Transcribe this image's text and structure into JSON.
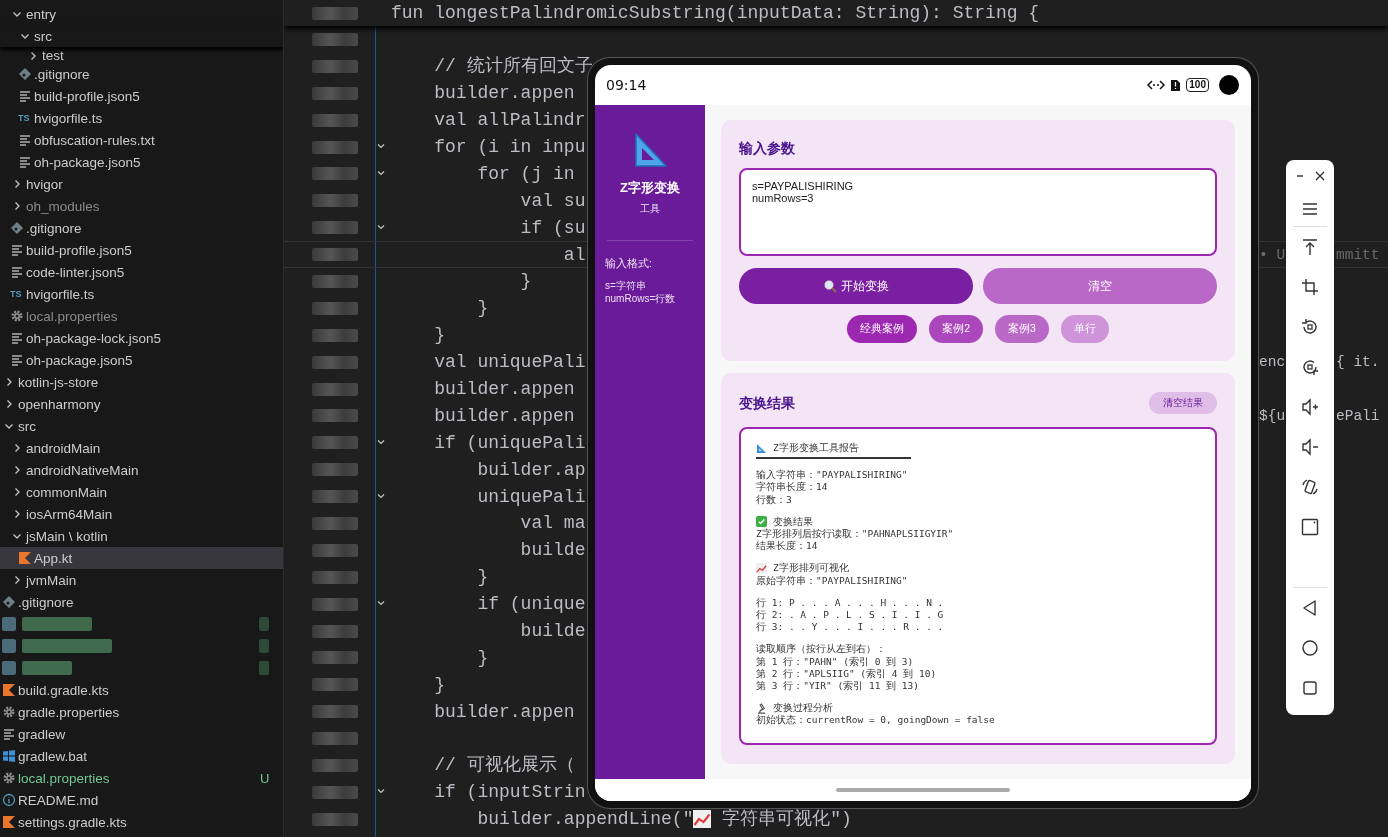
{
  "explorer": {
    "partial_children": [
      {
        "label": "entry",
        "kind": "folder",
        "expanded": true,
        "selected": false,
        "dimmed": false,
        "children": [
          {
            "label": "src",
            "kind": "folder",
            "expanded": true,
            "selected": false,
            "dimmed": false,
            "children": [
              {
                "label": "test",
                "kind": "folder",
                "expanded": false,
                "selected": false,
                "dimmed": false
              }
            ]
          },
          {
            "label": ".gitignore",
            "kind": "git",
            "selected": false,
            "dimmed": false
          },
          {
            "label": "build-profile.json5",
            "kind": "text",
            "selected": false,
            "dimmed": false
          },
          {
            "label": "hvigorfile.ts",
            "kind": "ts",
            "icon_text": "TS",
            "selected": false,
            "dimmed": false
          },
          {
            "label": "obfuscation-rules.txt",
            "kind": "text",
            "selected": false,
            "dimmed": false
          },
          {
            "label": "oh-package.json5",
            "kind": "text",
            "selected": false,
            "dimmed": false
          }
        ]
      },
      {
        "label": "hvigor",
        "kind": "folder",
        "expanded": false,
        "selected": false,
        "dimmed": false
      },
      {
        "label": "oh_modules",
        "kind": "folder",
        "expanded": false,
        "selected": false,
        "dimmed": true
      },
      {
        "label": ".gitignore",
        "kind": "git",
        "selected": false,
        "dimmed": false
      },
      {
        "label": "build-profile.json5",
        "kind": "text",
        "selected": false,
        "dimmed": false
      },
      {
        "label": "code-linter.json5",
        "kind": "text",
        "selected": false,
        "dimmed": false
      },
      {
        "label": "hvigorfile.ts",
        "kind": "ts",
        "icon_text": "TS",
        "selected": false,
        "dimmed": false
      },
      {
        "label": "local.properties",
        "kind": "gear",
        "selected": false,
        "dimmed": true
      },
      {
        "label": "oh-package-lock.json5",
        "kind": "text",
        "selected": false,
        "dimmed": false
      },
      {
        "label": "oh-package.json5",
        "kind": "text",
        "selected": false,
        "dimmed": false
      }
    ],
    "items": [
      {
        "label": "kotlin-js-store",
        "kind": "folder",
        "expanded": false,
        "selected": false,
        "dimmed": false
      },
      {
        "label": "openharmony",
        "kind": "folder",
        "expanded": false,
        "selected": false,
        "dimmed": false
      },
      {
        "label": "src",
        "kind": "folder",
        "expanded": true,
        "selected": false,
        "dimmed": false,
        "children": [
          {
            "label": "androidMain",
            "kind": "folder",
            "expanded": false,
            "selected": false,
            "dimmed": false
          },
          {
            "label": "androidNativeMain",
            "kind": "folder",
            "expanded": false,
            "selected": false,
            "dimmed": false
          },
          {
            "label": "commonMain",
            "kind": "folder",
            "expanded": false,
            "selected": false,
            "dimmed": false
          },
          {
            "label": "iosArm64Main",
            "kind": "folder",
            "expanded": false,
            "selected": false,
            "dimmed": false
          },
          {
            "label": "jsMain \\ kotlin",
            "kind": "folder",
            "expanded": true,
            "selected": false,
            "dimmed": false,
            "children": [
              {
                "label": "App.kt",
                "kind": "kotlin",
                "selected": true,
                "dimmed": false
              }
            ]
          },
          {
            "label": "jvmMain",
            "kind": "folder",
            "expanded": false,
            "selected": false,
            "dimmed": false
          }
        ]
      },
      {
        "label": ".gitignore",
        "kind": "git",
        "selected": false,
        "dimmed": false
      },
      {
        "kind": "redacted",
        "selected": false,
        "dimmed": false
      },
      {
        "kind": "redacted",
        "selected": false,
        "dimmed": false
      },
      {
        "kind": "redacted",
        "selected": false,
        "dimmed": false
      },
      {
        "label": "build.gradle.kts",
        "kind": "kotlin",
        "selected": false,
        "dimmed": false
      },
      {
        "label": "gradle.properties",
        "kind": "gear",
        "selected": false,
        "dimmed": false
      },
      {
        "label": "gradlew",
        "kind": "text",
        "selected": false,
        "dimmed": false
      },
      {
        "label": "gradlew.bat",
        "kind": "windows",
        "selected": false,
        "dimmed": false
      },
      {
        "label": "local.properties",
        "kind": "gear",
        "selected": false,
        "dimmed": false,
        "status": "U"
      },
      {
        "label": "README.md",
        "kind": "info",
        "selected": false,
        "dimmed": false
      },
      {
        "label": "settings.gradle.kts",
        "kind": "kotlin",
        "selected": false,
        "dimmed": false
      }
    ]
  },
  "editor": {
    "sticky_line": "fun longestPalindromicSubstring(inputData: String): String {",
    "lines": [
      {
        "foldable": false,
        "current": false
      },
      {
        "text": "    // 统计所有回文子",
        "foldable": false,
        "current": false
      },
      {
        "text": "    builder.appen",
        "foldable": false,
        "current": false
      },
      {
        "text": "    val allPalindr",
        "foldable": false,
        "current": false
      },
      {
        "text": "    for (i in inpu",
        "foldable": true,
        "current": false
      },
      {
        "text": "        for (j in",
        "foldable": true,
        "current": false
      },
      {
        "text": "            val su",
        "foldable": false,
        "current": false
      },
      {
        "text": "            if (su",
        "foldable": true,
        "current": false
      },
      {
        "text": "                al",
        "foldable": false,
        "current": true,
        "blame": [
          "• U",
          "mmitt"
        ]
      },
      {
        "text": "            }",
        "foldable": false,
        "current": false
      },
      {
        "text": "        }",
        "foldable": false,
        "current": false
      },
      {
        "text": "    }",
        "foldable": false,
        "current": false
      },
      {
        "text": "    val uniquePali",
        "foldable": false,
        "current": false,
        "tail": [
          "enc",
          "{ it."
        ]
      },
      {
        "text": "    builder.appen",
        "foldable": false,
        "current": false
      },
      {
        "text": "    builder.appen",
        "foldable": false,
        "current": false,
        "tail": [
          "${u",
          "ePali"
        ]
      },
      {
        "text": "    if (uniquePali",
        "foldable": true,
        "current": false
      },
      {
        "text": "        builder.ap",
        "foldable": false,
        "current": false
      },
      {
        "text": "        uniquePali",
        "foldable": true,
        "current": false
      },
      {
        "text": "            val ma",
        "foldable": false,
        "current": false
      },
      {
        "text": "            builde",
        "foldable": false,
        "current": false
      },
      {
        "text": "        }",
        "foldable": false,
        "current": false
      },
      {
        "text": "        if (unique",
        "foldable": true,
        "current": false
      },
      {
        "text": "            builde",
        "foldable": false,
        "current": false
      },
      {
        "text": "        }",
        "foldable": false,
        "current": false
      },
      {
        "text": "    }",
        "foldable": false,
        "current": false
      },
      {
        "text": "    builder.appen",
        "foldable": false,
        "current": false
      },
      {
        "foldable": false,
        "current": false
      },
      {
        "text": "    // 可视化展示（",
        "foldable": false,
        "current": false
      },
      {
        "text": "    if (inputStrin",
        "foldable": true,
        "current": false
      },
      {
        "text": "        builder.appendLine(\"",
        "rest": " 字符串可视化\")",
        "foldable": false,
        "current": false
      }
    ]
  },
  "phone": {
    "status_bar": {
      "time": "09:14",
      "battery": "100"
    },
    "sidebar": {
      "title": "Z字形变换",
      "subtitle": "工具",
      "format_label": "输入格式:",
      "format_lines": [
        "s=字符串",
        "numRows=行数"
      ]
    },
    "input_card": {
      "title": "输入参数",
      "value": "s=PAYPALISHIRING\nnumRows=3",
      "buttons": [
        {
          "label": "开始变换",
          "kind": "primary"
        },
        {
          "label": "清空",
          "kind": "secondary"
        }
      ],
      "examples": [
        {
          "label": "经典案例",
          "color": "#9c27b0"
        },
        {
          "label": "案例2",
          "color": "#ab47bc"
        },
        {
          "label": "案例3",
          "color": "#ba68c8"
        },
        {
          "label": "单行",
          "color": "#ce93d8"
        }
      ]
    },
    "result_card": {
      "title": "变换结果",
      "clear_button": "清空结果",
      "report": [
        {
          "heading": {
            "kind": "title",
            "text": "Z字形变换工具报告"
          }
        },
        {
          "lines": [
            "输入字符串：\"PAYPALISHIRING\"",
            "字符串长度：14",
            "行数：3"
          ]
        },
        {
          "heading": {
            "kind": "section",
            "text": "变换结果"
          },
          "lines": [
            "Z字形排列后按行读取：\"PAHNAPLSIIGYIR\"",
            "结果长度：14"
          ]
        },
        {
          "heading": {
            "kind": "section",
            "text": "Z字形排列可视化"
          },
          "lines": [
            "原始字符串：\"PAYPALISHIRING\""
          ]
        },
        {
          "lines": [
            "行 1: P . . . A . . . H . . . N .",
            "行 2: . A . P . L . S . I . I . G",
            "行 3: . . Y . . . I . . . R . . ."
          ]
        },
        {
          "lines": [
            "读取顺序（按行从左到右）：",
            "第 1 行：\"PAHN\" (索引 0 到 3)",
            "第 2 行：\"APLSIIG\" (索引 4 到 10)",
            "第 3 行：\"YIR\" (索引 11 到 13)"
          ]
        },
        {
          "heading": {
            "kind": "section",
            "text": "变换过程分析"
          },
          "lines": [
            "初始状态：currentRow = 0, goingDown = false"
          ]
        }
      ]
    }
  }
}
